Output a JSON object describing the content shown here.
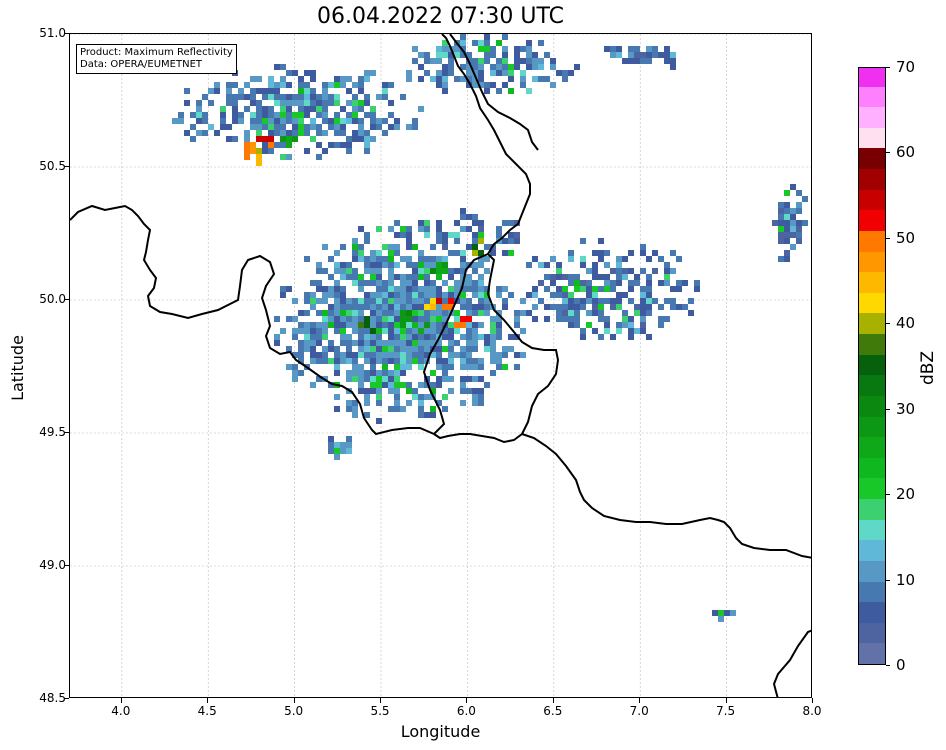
{
  "title": "06.04.2022 07:30 UTC",
  "xlabel": "Longitude",
  "ylabel": "Latitude",
  "info_box": {
    "product": "Product: Maximum Reflectivity",
    "data": "Data: OPERA/EUMETNET"
  },
  "x_ticks": [
    "4.0",
    "4.5",
    "5.0",
    "5.5",
    "6.0",
    "6.5",
    "7.0",
    "7.5",
    "8.0"
  ],
  "y_ticks": [
    "51.0",
    "50.5",
    "50.0",
    "49.5",
    "49.0",
    "48.5"
  ],
  "extent": {
    "lon_min": 3.7,
    "lon_max": 8.0,
    "lat_min": 48.5,
    "lat_max": 51.0
  },
  "colorbar": {
    "label": "dBZ",
    "ticks": [
      "0",
      "10",
      "20",
      "30",
      "40",
      "50",
      "60",
      "70"
    ],
    "min": 0,
    "max": 70,
    "colors": [
      "#6271a8",
      "#4e64a0",
      "#3e5b9f",
      "#4878b0",
      "#5898c4",
      "#5fb8d8",
      "#60d8c8",
      "#3cd070",
      "#18c828",
      "#10b820",
      "#0ea818",
      "#0c9814",
      "#0a8810",
      "#087810",
      "#06600c",
      "#407a0a",
      "#a8b000",
      "#ffd800",
      "#ffb800",
      "#ff9800",
      "#ff7800",
      "#f00000",
      "#c80000",
      "#a00000",
      "#780000",
      "#ffe0f0",
      "#ffb0ff",
      "#ff80ff",
      "#f030f0"
    ]
  },
  "reflectivity_cells": [
    {
      "lat": 49.93,
      "lon": 5.55,
      "dbz": 22
    },
    {
      "lat": 49.95,
      "lon": 5.62,
      "dbz": 30
    },
    {
      "lat": 49.9,
      "lon": 5.7,
      "dbz": 28
    },
    {
      "lat": 49.98,
      "lon": 5.75,
      "dbz": 45
    },
    {
      "lat": 49.92,
      "lon": 5.42,
      "dbz": 40
    },
    {
      "lat": 50.12,
      "lon": 5.82,
      "dbz": 30
    },
    {
      "lat": 50.0,
      "lon": 5.87,
      "dbz": 55
    },
    {
      "lat": 49.93,
      "lon": 5.95,
      "dbz": 55
    },
    {
      "lat": 50.22,
      "lon": 6.05,
      "dbz": 40
    },
    {
      "lat": 50.6,
      "lon": 4.82,
      "dbz": 55
    },
    {
      "lat": 50.58,
      "lon": 4.72,
      "dbz": 50
    },
    {
      "lat": 50.56,
      "lon": 4.78,
      "dbz": 45
    },
    {
      "lat": 50.62,
      "lon": 4.95,
      "dbz": 30
    },
    {
      "lat": 50.06,
      "lon": 6.6,
      "dbz": 25
    },
    {
      "lat": 49.45,
      "lon": 5.27,
      "dbz": 15
    },
    {
      "lat": 49.7,
      "lon": 5.45,
      "dbz": 22
    },
    {
      "lat": 49.8,
      "lon": 5.6,
      "dbz": 15
    }
  ]
}
